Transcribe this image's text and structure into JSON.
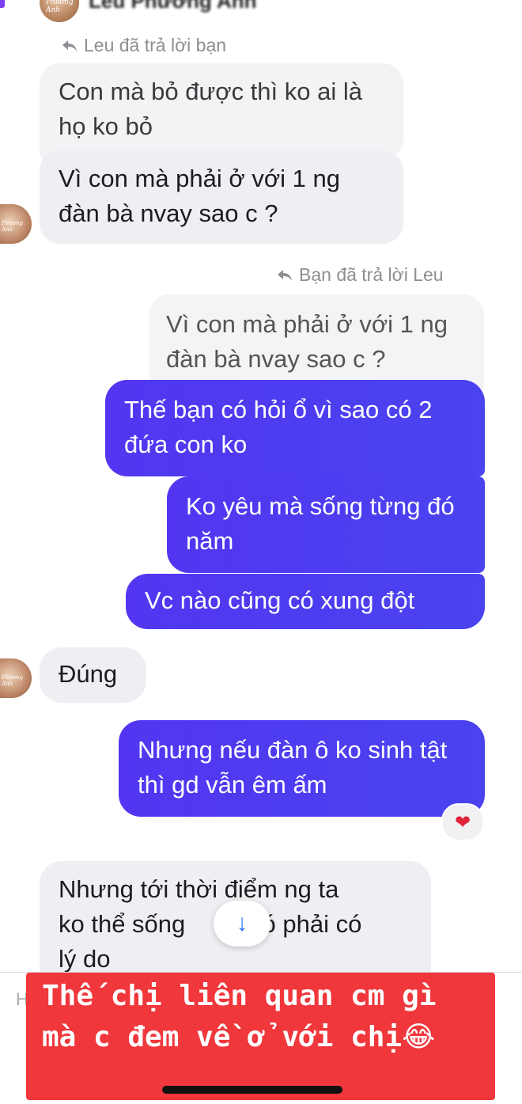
{
  "header": {
    "contact_name": "Leu Phương Anh",
    "avatar_text": "Phương Anh"
  },
  "messages": {
    "reply_label_1": "Leu đã trả lời bạn",
    "in_1": "Con mà bỏ được thì ko ai là họ ko bỏ",
    "in_2": "Vì con mà phải ở với 1 ng đàn bà nvay sao c ?",
    "reply_label_2": "Bạn đã trả lời Leu",
    "quoted": "Vì con mà phải ở với 1 ng đàn bà nvay sao c ?",
    "out_1": "Thế bạn có hỏi ổ vì sao có 2 đứa con ko",
    "out_2": "Ko yêu mà sống từng đó năm",
    "out_3": "Vc nào cũng có xung đột",
    "in_3": "Đúng",
    "out_4": "Nhưng nếu đàn ô ko sinh tật thì gd vẫn êm ấm",
    "reaction": "❤",
    "in_4_line1": "Nhưng tới thời điểm ng ta",
    "in_4_line2a": "ko thể sống",
    "in_4_line2b": "nó phải có",
    "in_4_line3": "lý do"
  },
  "scroll_button": "↓",
  "caption": {
    "text": "Thế chị liên quan cm gì mà c đem về ở với chị",
    "emoji": "😂"
  },
  "colors": {
    "outgoing": "#4d3bf0",
    "incoming": "#efeff3",
    "caption_bg": "#f0373c"
  }
}
